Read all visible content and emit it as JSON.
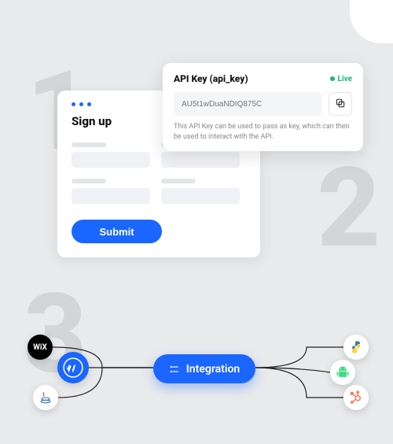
{
  "big_numbers": {
    "one": "1",
    "two": "2",
    "three": "3"
  },
  "signup": {
    "title": "Sign up",
    "submit_label": "Submit"
  },
  "apikey": {
    "title": "API Key (api_key)",
    "badge": "Live",
    "value": "AU5t1wDuaNDIQ875C",
    "description": "This API Key can be used to pass as key, which can then be used to interact with the API."
  },
  "integration": {
    "label": "Integration",
    "left_icons": {
      "wix": "WiX",
      "wordpress": "WordPress",
      "java": "Java"
    },
    "right_icons": {
      "python": "Python",
      "android": "Android",
      "hubspot": "HubSpot"
    }
  }
}
